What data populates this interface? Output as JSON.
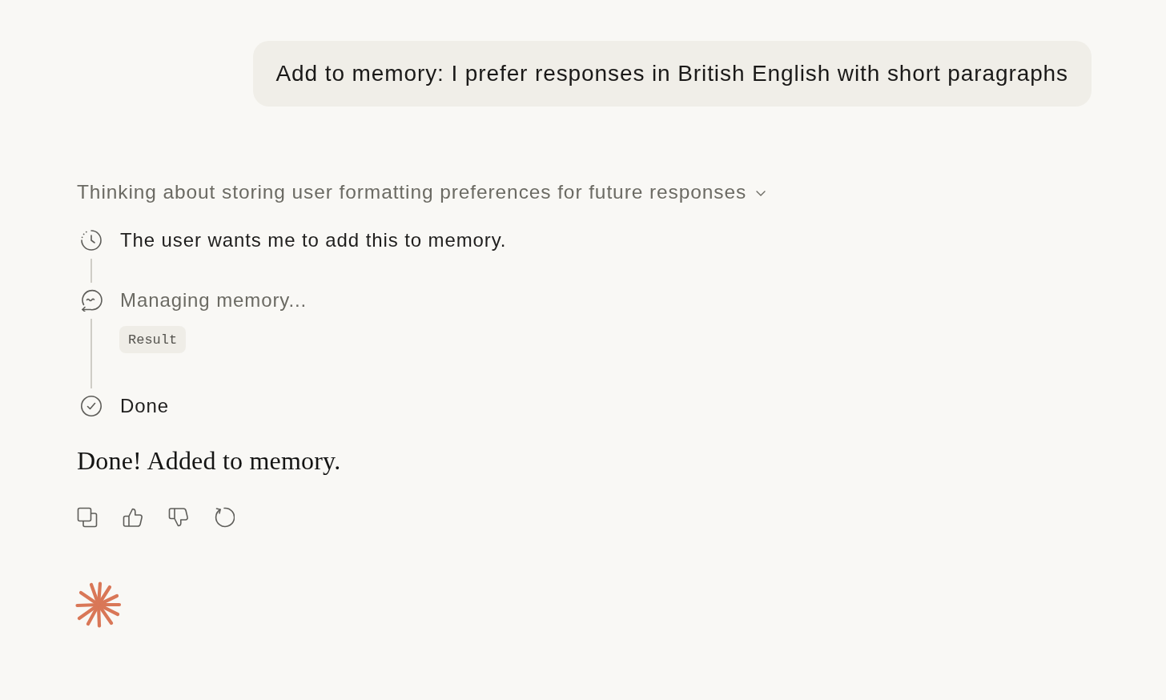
{
  "user_message": {
    "text": "Add to memory: I prefer responses in British English with short paragraphs"
  },
  "thinking": {
    "summary": "Thinking about storing user formatting preferences for future responses",
    "steps": [
      {
        "kind": "thought",
        "text": "The user wants me to add this to memory."
      },
      {
        "kind": "tool",
        "text": "Managing memory...",
        "result": "Result"
      },
      {
        "kind": "done",
        "text": "Done"
      }
    ]
  },
  "reply": {
    "text": "Done! Added to memory."
  }
}
